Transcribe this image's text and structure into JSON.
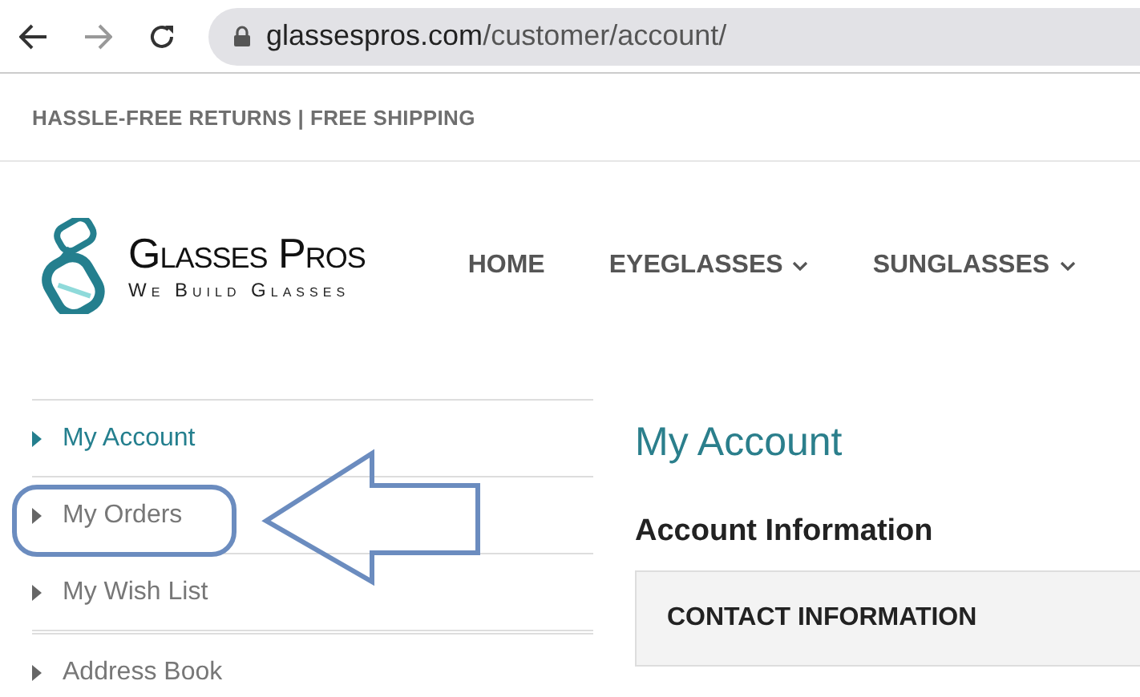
{
  "browser": {
    "url_host": "glassespros.com",
    "url_path": "/customer/account/"
  },
  "promo_bar": {
    "text": "HASSLE-FREE RETURNS | FREE SHIPPING"
  },
  "logo": {
    "name": "Glasses Pros",
    "tagline": "We Build Glasses"
  },
  "nav": [
    {
      "label": "HOME",
      "kind": "link"
    },
    {
      "label": "EYEGLASSES",
      "kind": "dropdown"
    },
    {
      "label": "SUNGLASSES",
      "kind": "dropdown"
    }
  ],
  "sidebar": {
    "items": [
      {
        "label": "My Account",
        "selected": true
      },
      {
        "label": "My Orders",
        "selected": false
      },
      {
        "label": "My Wish List",
        "selected": false
      },
      {
        "label": "Address Book",
        "selected": false
      }
    ]
  },
  "main": {
    "title": "My Account",
    "section_title": "Account Information",
    "panel_title": "CONTACT INFORMATION"
  }
}
